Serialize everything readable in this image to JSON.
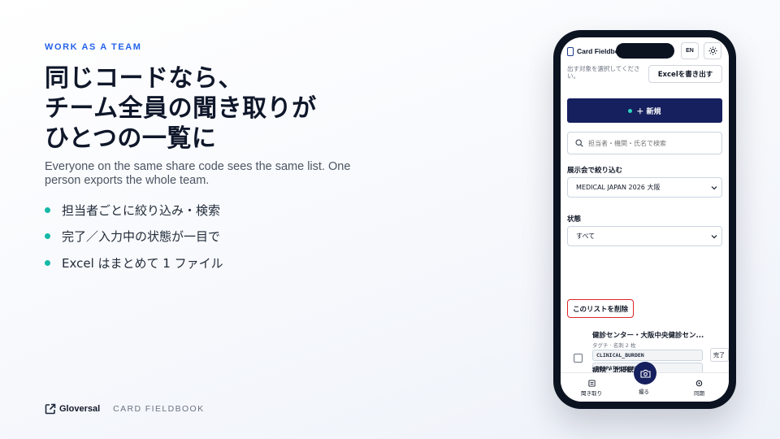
{
  "slide": {
    "eyebrow": "WORK AS A TEAM",
    "headline": [
      "同じコードなら、",
      "チーム全員の聞き取りが",
      "ひとつの一覧に"
    ],
    "subtext": "Everyone on the same share code sees the same list. One person exports the whole team.",
    "bullets": [
      "担当者ごとに絞り込み・検索",
      "完了／入力中の状態が一目で",
      "Excel はまとめて 1 ファイル"
    ],
    "accent_color": "#2563eb",
    "bullet_color": "#14b8a6"
  },
  "footer": {
    "brand": "Gloversal",
    "product": "CARD FIELDBOOK",
    "logo_icon": "external-link-square-icon"
  },
  "phone": {
    "app_title": "Card Fieldbook",
    "lang_button": "EN",
    "theme_icon": "sun-icon",
    "cut_text": "出す対象を選択してください。",
    "excel_button": "Excelを書き出す",
    "new_button": "＋ 新規",
    "search_placeholder": "担当者・機関・氏名で検索",
    "filter_label": "展示会で絞り込む",
    "filter_value": "MEDICAL JAPAN 2026 大阪",
    "status_label": "状態",
    "status_value": "すべて",
    "delete_button": "このリストを削除",
    "cards": [
      {
        "title": "健診センター・大阪中央健診セン...",
        "meta": "タグチ · 名刺 2 枚",
        "tags": [
          "CLINICAL_BURDEN",
          "DISPATCH_DEPENDENT"
        ],
        "action": "完了"
      },
      {
        "title": "病院・北摂総合病院"
      }
    ],
    "tabs": [
      {
        "label": "聞き取り",
        "icon": "list-icon"
      },
      {
        "label": "撮る",
        "icon": "camera-icon"
      },
      {
        "label": "同期",
        "icon": "sync-icon"
      }
    ],
    "primary_color": "#16205e"
  }
}
